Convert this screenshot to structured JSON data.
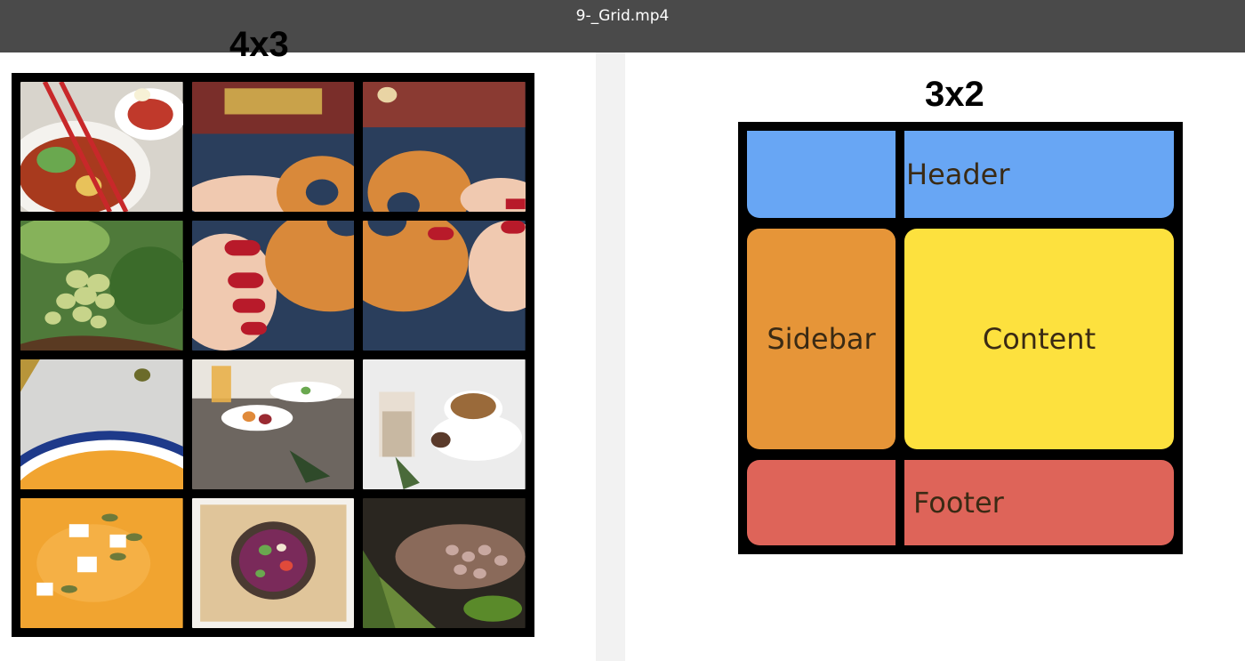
{
  "window": {
    "title": "9-_Grid.mp4"
  },
  "left_example": {
    "heading": "4x3",
    "tiles": [
      {
        "name": "ramen-bowl-photo"
      },
      {
        "name": "donut-hands-top-center-photo"
      },
      {
        "name": "donut-hands-top-right-photo"
      },
      {
        "name": "grapes-vine-photo"
      },
      {
        "name": "donut-hands-middle-center-photo"
      },
      {
        "name": "donut-hands-middle-right-photo"
      },
      {
        "name": "pumpkin-soup-bowl-photo"
      },
      {
        "name": "breakfast-table-photo"
      },
      {
        "name": "coffee-cup-photo"
      },
      {
        "name": "soup-with-seeds-photo"
      },
      {
        "name": "salad-bowl-board-photo"
      },
      {
        "name": "vegetable-market-photo"
      }
    ]
  },
  "right_example": {
    "heading": "3x2",
    "cells": {
      "header": "Header",
      "sidebar": "Sidebar",
      "content": "Content",
      "footer": "Footer"
    }
  },
  "colors": {
    "header": "#68a6f4",
    "sidebar": "#e69538",
    "content": "#fde13e",
    "footer": "#de6459"
  }
}
